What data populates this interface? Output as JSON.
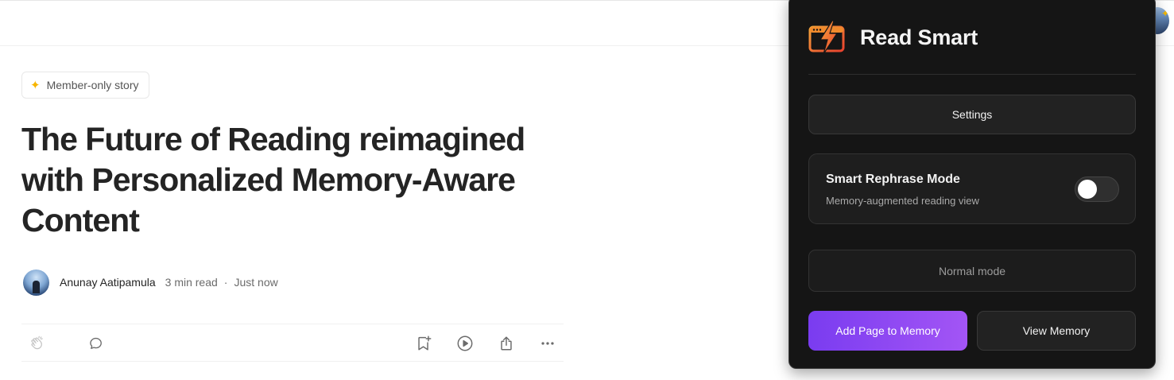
{
  "article": {
    "badge_label": "Member-only story",
    "title": "The Future of Reading reimagined with Personalized Memory-Aware Content",
    "author_name": "Anunay Aatipamula",
    "read_time": "3 min read",
    "separator": "·",
    "posted": "Just now",
    "actions": [
      "clap-icon",
      "comment-icon",
      "bookmark-add-icon",
      "listen-play-icon",
      "share-icon",
      "more-icon"
    ]
  },
  "extension": {
    "title": "Read Smart",
    "settings_label": "Settings",
    "mode_title": "Smart Rephrase Mode",
    "mode_subtitle": "Memory-augmented reading view",
    "mode_toggle_on": false,
    "mode_status": "Normal mode",
    "add_page_label": "Add Page to Memory",
    "view_memory_label": "View Memory",
    "colors": {
      "panel_bg": "#151515",
      "accent_gradient_start": "#7a3cf0",
      "accent_gradient_end": "#a355f5",
      "logo_orange": "#f08a2c",
      "logo_red": "#e8412e"
    }
  }
}
